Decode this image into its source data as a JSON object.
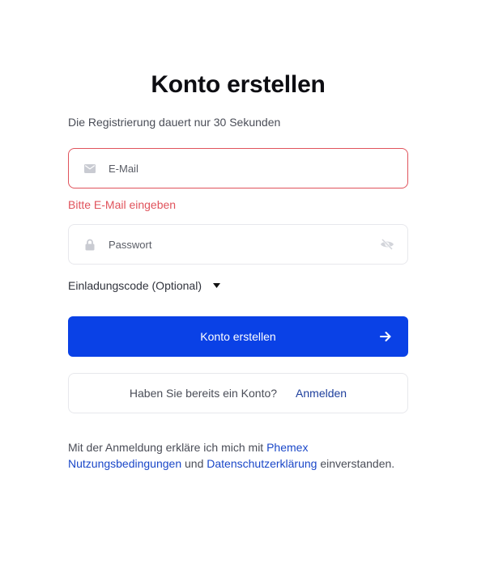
{
  "page": {
    "title": "Konto erstellen",
    "subtitle": "Die Registrierung dauert nur 30 Sekunden"
  },
  "email": {
    "value": "",
    "placeholder": "E-Mail",
    "icon": "mail-icon",
    "error": "Bitte E-Mail eingeben",
    "state": "error"
  },
  "password": {
    "value": "",
    "placeholder": "Passwort",
    "icon": "lock-icon",
    "toggle_icon": "eye-off-icon"
  },
  "invite": {
    "label": "Einladungscode (Optional)",
    "icon": "caret-down-icon",
    "expanded": false
  },
  "submit": {
    "label": "Konto erstellen",
    "icon": "arrow-right-icon"
  },
  "login": {
    "question": "Haben Sie bereits ein Konto?",
    "link_label": "Anmelden"
  },
  "legal": {
    "prefix": "Mit der Anmeldung erkläre ich mich mit ",
    "terms_link": "Phemex Nutzungsbedingungen",
    "middle": " und ",
    "privacy_link": "Datenschutzerklärung",
    "suffix": " einverstanden."
  },
  "colors": {
    "primary": "#0a41e6",
    "error": "#e0535c",
    "link": "#1a47c8",
    "border": "#e7e8ec"
  }
}
